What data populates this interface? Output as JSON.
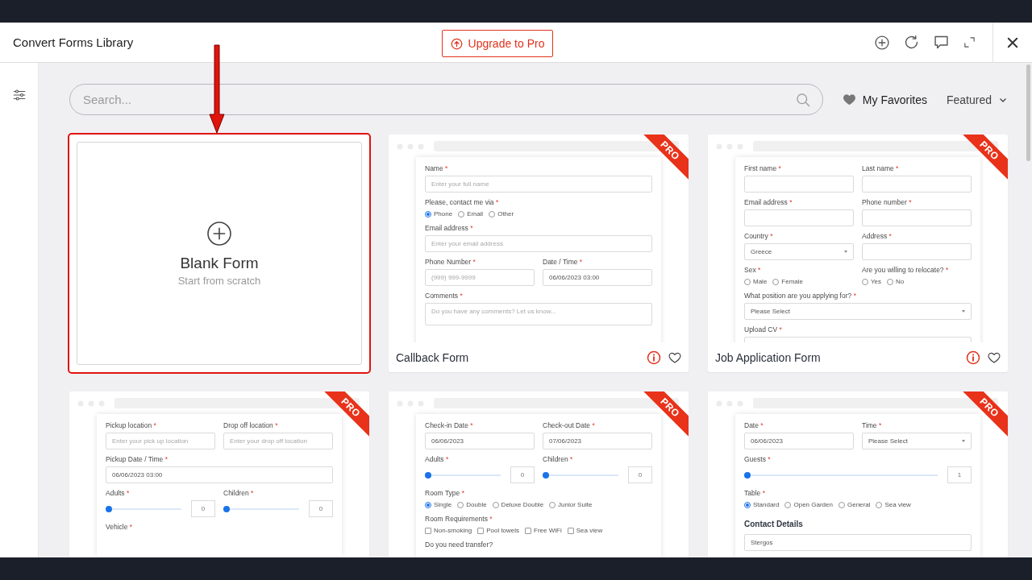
{
  "window": {
    "title": "Convert Forms Library"
  },
  "upgrade_button": "Upgrade to Pro",
  "search": {
    "placeholder": "Search..."
  },
  "favorites": "My Favorites",
  "sort": {
    "value": "Featured"
  },
  "blank_card": {
    "title": "Blank Form",
    "subtitle": "Start from scratch",
    "highlighted": true
  },
  "templates": [
    {
      "title": "Callback Form",
      "badge": "PRO",
      "rows": [
        [
          {
            "kind": "input",
            "label": "Name",
            "mark": "*",
            "placeholder": "Enter your full name"
          }
        ],
        [
          {
            "kind": "radio",
            "label": "Please, contact me via",
            "mark": "*",
            "options": [
              {
                "label": "Phone",
                "selected": true
              },
              {
                "label": "Email",
                "selected": false
              },
              {
                "label": "Other",
                "selected": false
              }
            ]
          }
        ],
        [
          {
            "kind": "input",
            "label": "Email address",
            "mark": "*",
            "placeholder": "Enter your email address"
          }
        ],
        [
          {
            "kind": "input",
            "label": "Phone Number",
            "mark": "*",
            "placeholder": "(999) 999-9999"
          },
          {
            "kind": "input",
            "label": "Date / Time",
            "mark": "*",
            "value": "06/06/2023 03:00"
          }
        ],
        [
          {
            "kind": "textarea",
            "label": "Comments",
            "mark": "*",
            "placeholder": "Do you have any comments? Let us know..."
          }
        ]
      ]
    },
    {
      "title": "Job Application Form",
      "badge": "PRO",
      "rows": [
        [
          {
            "kind": "input",
            "label": "First name",
            "mark": "*"
          },
          {
            "kind": "input",
            "label": "Last name",
            "mark": "*"
          }
        ],
        [
          {
            "kind": "input",
            "label": "Email address",
            "mark": "*"
          },
          {
            "kind": "input",
            "label": "Phone number",
            "mark": "*"
          }
        ],
        [
          {
            "kind": "select",
            "label": "Country",
            "mark": "*",
            "value": "Greece"
          },
          {
            "kind": "input",
            "label": "Address",
            "mark": "*"
          }
        ],
        [
          {
            "kind": "radio",
            "label": "Sex",
            "mark": "*",
            "options": [
              {
                "label": "Male",
                "selected": false
              },
              {
                "label": "Female",
                "selected": false
              }
            ]
          },
          {
            "kind": "radio",
            "label": "Are you willing to relocate?",
            "mark": "*",
            "options": [
              {
                "label": "Yes",
                "selected": false
              },
              {
                "label": "No",
                "selected": false
              }
            ]
          }
        ],
        [
          {
            "kind": "select",
            "label": "What position are you applying for?",
            "mark": "*",
            "value": "Please Select"
          }
        ],
        [
          {
            "kind": "textarea",
            "label": "Upload CV",
            "mark": "*"
          }
        ]
      ]
    },
    {
      "badge": "PRO",
      "rows": [
        [
          {
            "kind": "input",
            "label": "Pickup location",
            "mark": "*",
            "placeholder": "Enter your pick up location"
          },
          {
            "kind": "input",
            "label": "Drop off location",
            "mark": "*",
            "placeholder": "Enter your drop off location"
          }
        ],
        [
          {
            "kind": "input",
            "label": "Pickup Date / Time",
            "mark": "*",
            "value": "06/06/2023 03:00"
          }
        ],
        [
          {
            "kind": "slider",
            "label": "Adults",
            "mark": "*",
            "level": 0,
            "value": "0"
          },
          {
            "kind": "slider",
            "label": "Children",
            "mark": "*",
            "level": 0,
            "value": "0"
          }
        ],
        [
          {
            "kind": "label",
            "label": "Vehicle",
            "mark": "*"
          }
        ]
      ]
    },
    {
      "badge": "PRO",
      "rows": [
        [
          {
            "kind": "input",
            "label": "Check-in Date",
            "mark": "*",
            "value": "06/06/2023"
          },
          {
            "kind": "input",
            "label": "Check-out Date",
            "mark": "*",
            "value": "07/06/2023"
          }
        ],
        [
          {
            "kind": "slider",
            "label": "Adults",
            "mark": "*",
            "level": 0,
            "value": "0"
          },
          {
            "kind": "slider",
            "label": "Children",
            "mark": "*",
            "level": 0,
            "value": "0"
          }
        ],
        [
          {
            "kind": "radio",
            "label": "Room Type",
            "mark": "*",
            "options": [
              {
                "label": "Single",
                "selected": true
              },
              {
                "label": "Double",
                "selected": false
              },
              {
                "label": "Deluxe Double",
                "selected": false
              },
              {
                "label": "Junior Suite",
                "selected": false
              }
            ]
          }
        ],
        [
          {
            "kind": "checkbox",
            "label": "Room Requirements",
            "mark": "*",
            "options": [
              {
                "label": "Non-smoking",
                "checked": false
              },
              {
                "label": "Pool towels",
                "checked": false
              },
              {
                "label": "Free WiFi",
                "checked": false
              },
              {
                "label": "Sea view",
                "checked": false
              }
            ]
          }
        ],
        [
          {
            "kind": "label",
            "label": "Do you need transfer?"
          }
        ]
      ]
    },
    {
      "badge": "PRO",
      "rows": [
        [
          {
            "kind": "input",
            "label": "Date",
            "mark": "*",
            "value": "06/06/2023"
          },
          {
            "kind": "select",
            "label": "Time",
            "mark": "*",
            "value": "Please Select"
          }
        ],
        [
          {
            "kind": "slider",
            "label": "Guests",
            "mark": "*",
            "level": 0,
            "value": "1"
          }
        ],
        [
          {
            "kind": "radio",
            "label": "Table",
            "mark": "*",
            "options": [
              {
                "label": "Standard",
                "selected": true
              },
              {
                "label": "Open Garden",
                "selected": false
              },
              {
                "label": "General",
                "selected": false
              },
              {
                "label": "Sea view",
                "selected": false
              }
            ]
          }
        ],
        [
          {
            "kind": "heading",
            "label": "Contact Details"
          }
        ],
        [
          {
            "kind": "input",
            "value": "Stergos"
          }
        ]
      ]
    }
  ]
}
